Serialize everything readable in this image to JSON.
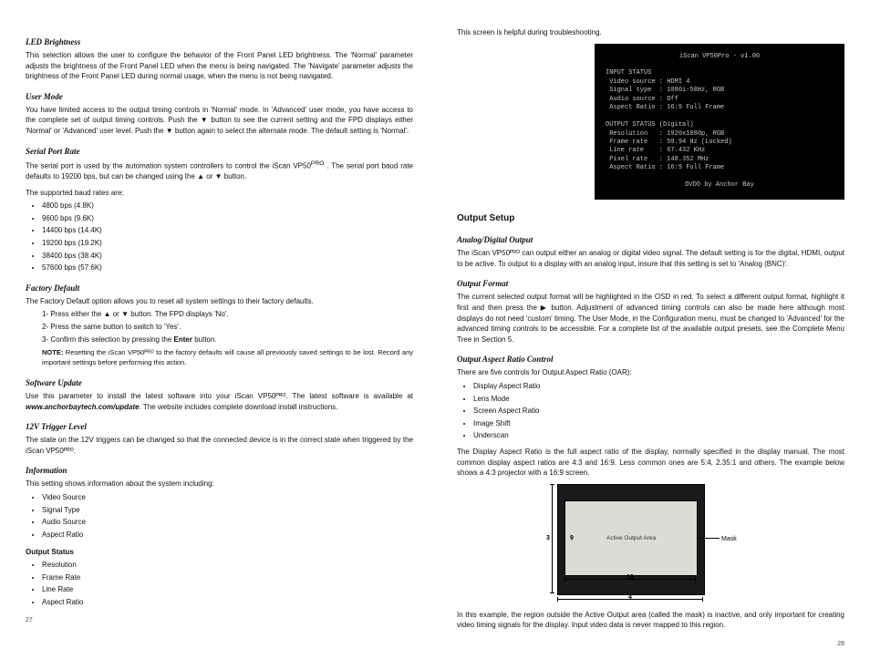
{
  "left": {
    "ledBrightness": {
      "title": "LED Brightness",
      "body": "This selection allows the user to configure the behavior of the Front Panel LED brightness. The 'Normal' parameter adjusts the brightness of the Front Panel LED when the menu is being navigated. The 'Navigate' parameter adjusts the brightness of the Front Panel LED during normal usage, when the menu is not being navigated."
    },
    "userMode": {
      "title": "User Mode",
      "body": "You have limited access to the output timing controls in 'Normal' mode. In 'Advanced' user mode, you have access to the complete set of output timing controls. Push the ▼ button to see the current setting and the FPD displays either 'Normal' or 'Advanced' user level. Push the ▼ button again to select the alternate mode. The default setting is 'Normal'."
    },
    "serialPortRate": {
      "title": "Serial Port Rate",
      "body1": "The serial port is used by the automation system controllers to control the iScan VP50",
      "body1b": " . The serial port baud rate defaults to 19200 bps, but can be changed using the ▲ or ▼ button.",
      "support": "The supported baud rates are:",
      "rates": [
        "4800 bps (4.8K)",
        "9600 bps (9.6K)",
        "14400 bps (14.4K)",
        "19200 bps (19.2K)",
        "38400 bps (38.4K)",
        "57600 bps (57.6K)"
      ]
    },
    "factoryDefault": {
      "title": "Factory Default",
      "body": "The Factory Default option allows you to reset all system settings to their factory defaults.",
      "steps": [
        "1- Press either the ▲ or ▼ button. The FPD displays 'No'.",
        "2- Press the same button to switch to 'Yes'.",
        "3- Confirm this selection by pressing the Enter button."
      ],
      "noteLabel": "NOTE:",
      "note": " Resetting the iScan VP50ᴾᴿᴼ to the factory defaults will cause all previously saved settings to be lost. Record any important settings before performing this action."
    },
    "softwareUpdate": {
      "title": "Software Update",
      "body1": "Use this parameter to install the latest software into your iScan VP50ᴾᴿᴼ. The latest software is available at ",
      "url": "www.anchorbaytech.com/update",
      "body2": ". The website includes complete download install instructions."
    },
    "trigger": {
      "title": "12V Trigger Level",
      "body": "The state on the 12V triggers can be changed so that the connected device is in the correct state when triggered by the iScan VP50ᴾᴿᴼ."
    },
    "information": {
      "title": "Information",
      "body": "This setting shows information about the system including:",
      "items": [
        "Video Source",
        "Signal Type",
        "Audio Source",
        "Aspect Ratio"
      ],
      "outputStatusTitle": "Output Status",
      "outputItems": [
        "Resolution",
        "Frame Rate",
        "Line Rate",
        "Aspect Ratio"
      ]
    },
    "pageNum": "27"
  },
  "right": {
    "intro": "This screen is helpful during troubleshooting.",
    "term": {
      "l0": "iScan VP50Pro - v1.00",
      "l1": "INPUT STATUS",
      "l2": " Video source : HDMI 4",
      "l3": " Signal type  : 1080i-50Hz, RGB",
      "l4": " Audio source : Off",
      "l5": " Aspect Ratio : 16:9 Full Frame",
      "l6": "OUTPUT STATUS (Digital)",
      "l7": " Resolution   : 1920x1080p, RGB",
      "l8": " Frame rate   : 59.94 Hz (Locked)",
      "l9": " Line rate    : 67.432 KHz",
      "l10": " Pixel rate   : 148.352 MHz",
      "l11": " Aspect Ratio : 16:9 Full Frame",
      "l12": "DVDO by Anchor Bay"
    },
    "outputSetupTitle": "Output Setup",
    "analogDigital": {
      "title": "Analog/Digital Output",
      "body": "The iScan VP50ᴾᴿᴼ can output either an analog or digital video signal. The default setting is for the digital, HDMI, output to be active. To output to a display with an analog input, insure that this setting is set to 'Analog (BNC)'."
    },
    "format": {
      "title": "Output Format",
      "body": "The current selected output format will be highlighted in the OSD in red. To select a different output format, highlight it first and then press the ▶ button. Adjustment of advanced timing controls can also be made here although most displays do not need 'custom' timing. The User Mode, in the Configuration menu, must be changed to 'Advanced' for the advanced timing controls to be accessible. For a complete list of the available output presets, see the Complete Menu Tree in Section 5."
    },
    "oar": {
      "title": "Output Aspect Ratio Control",
      "lead": "There are five controls for Output Aspect Ratio (OAR):",
      "items": [
        "Display Aspect Ratio",
        "Lens Mode",
        "Screen Aspect Ratio",
        "Image Shift",
        "Underscan"
      ],
      "body": "The Display Aspect Ratio is the full aspect ratio of the display, normally specified in the display manual. The most common display aspect ratios are 4:3 and 16:9. Less common ones are 5:4, 2.35:1 and others. The example below shows a 4:3 projector with a 16:9 screen.",
      "diagram": {
        "activeLabel": "Active Output Area",
        "maskLabel": "Mask",
        "n3": "3",
        "n4": "4",
        "n9": "9",
        "n16": "16"
      },
      "foot": "In this example, the region outside the Active Output area (called the mask) is inactive, and only important for creating video timing signals for the display. Input video data is never mapped to this region."
    },
    "pageNum": "28"
  }
}
